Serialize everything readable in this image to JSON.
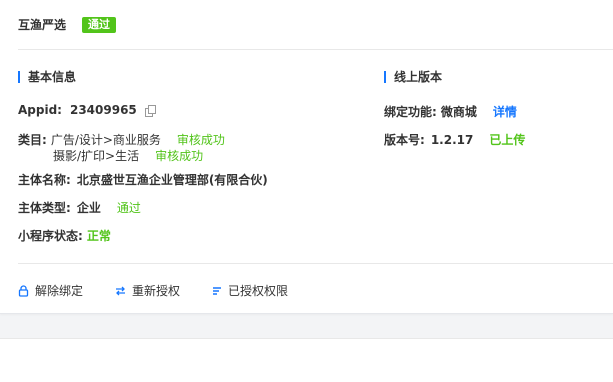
{
  "header": {
    "app_name": "互渔严选",
    "status_badge": "通过"
  },
  "basic_info": {
    "title": "基本信息",
    "appid_label": "Appid:",
    "appid_value": "23409965",
    "category_label": "类目:",
    "categories": [
      {
        "name": "广告/设计>商业服务",
        "status": "审核成功"
      },
      {
        "name": "摄影/扩印>生活",
        "status": "审核成功"
      }
    ],
    "subject_name_label": "主体名称:",
    "subject_name_value": "北京盛世互渔企业管理部(有限合伙)",
    "subject_type_label": "主体类型:",
    "subject_type_value": "企业",
    "subject_type_status": "通过",
    "mini_status_label": "小程序状态:",
    "mini_status_value": "正常"
  },
  "online_version": {
    "title": "线上版本",
    "bind_label": "绑定功能:",
    "bind_value": "微商城",
    "detail_link": "详情",
    "version_label": "版本号:",
    "version_value": "1.2.17",
    "version_status": "已上传"
  },
  "actions": {
    "unbind": "解除绑定",
    "reauthorize": "重新授权",
    "permissions": "已授权权限"
  },
  "colors": {
    "accent": "#1677ff",
    "success": "#52c41a"
  }
}
